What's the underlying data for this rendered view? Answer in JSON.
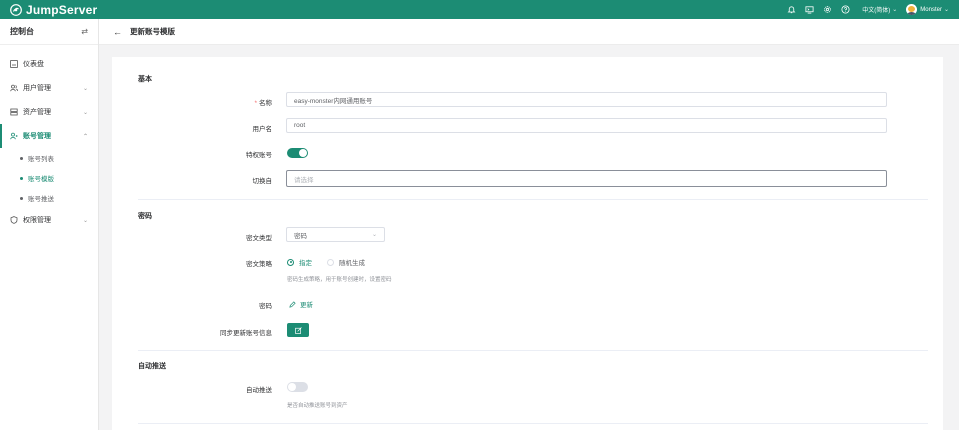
{
  "app": {
    "logo_text": "JumpServer"
  },
  "topbar": {
    "language": "中文(简体)",
    "username": "Monster",
    "icons": [
      "bell-icon",
      "screen-icon",
      "gear-icon",
      "help-icon"
    ]
  },
  "sidebar": {
    "title": "控制台",
    "items": [
      {
        "label": "仪表盘",
        "icon": "dashboard-icon"
      },
      {
        "label": "用户管理",
        "icon": "users-icon"
      },
      {
        "label": "资产管理",
        "icon": "assets-icon"
      },
      {
        "label": "账号管理",
        "icon": "accounts-icon"
      },
      {
        "label": "权限管理",
        "icon": "permissions-icon"
      }
    ],
    "subitems": [
      {
        "label": "账号列表"
      },
      {
        "label": "账号模版"
      },
      {
        "label": "账号推送"
      }
    ]
  },
  "page": {
    "back_label": "←",
    "title": "更新账号模版"
  },
  "form": {
    "basic": {
      "title": "基本",
      "name_label": "名称",
      "name_value": "easy-monster内网通用账号",
      "username_label": "用户名",
      "username_value": "root",
      "privileged_label": "特权账号",
      "privileged_on": true,
      "su_from_label": "切换自",
      "su_from_placeholder": "请选择"
    },
    "secret": {
      "title": "密码",
      "secret_type_label": "密文类型",
      "secret_type_value": "密码",
      "strategy_label": "密文策略",
      "strategy_options": [
        "指定",
        "随机生成"
      ],
      "strategy_selected": "指定",
      "strategy_help": "密码生成策略，用于账号创建时，设置密码",
      "password_label": "密码",
      "password_update": "更新",
      "sync_label": "同步更新账号信息"
    },
    "push": {
      "title": "自动推送",
      "auto_push_label": "自动推送",
      "auto_push_on": false,
      "auto_push_help": "是否自动推送账号到资产"
    }
  },
  "colors": {
    "primary": "#1c8c74",
    "required": "#f56c6c"
  }
}
